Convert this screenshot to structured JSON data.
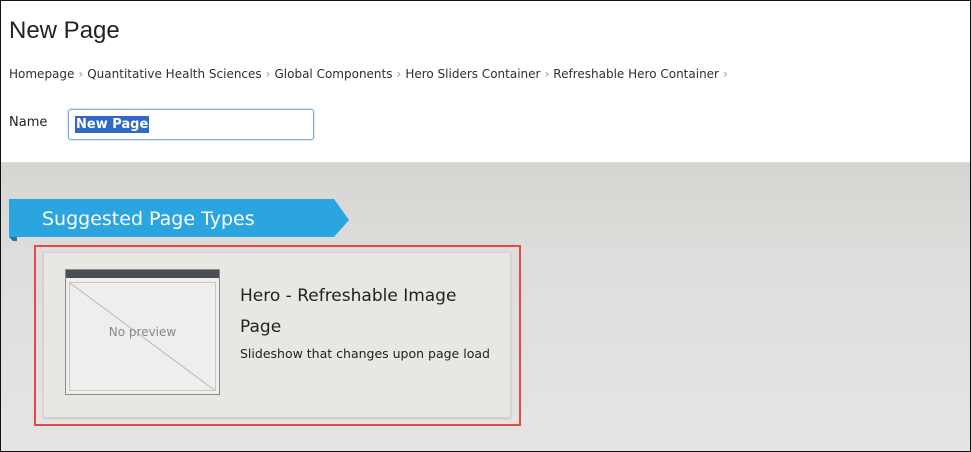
{
  "page": {
    "title": "New Page"
  },
  "breadcrumb": {
    "items": [
      "Homepage",
      "Quantitative Health Sciences",
      "Global Components",
      "Hero Sliders Container",
      "Refreshable Hero Container"
    ],
    "separator": "›"
  },
  "name_field": {
    "label": "Name",
    "value": "New Page"
  },
  "suggested": {
    "heading": "Suggested Page Types",
    "cards": [
      {
        "title": "Hero - Refreshable Image Page",
        "description": "Slideshow that changes upon page load",
        "preview_text": "No preview"
      }
    ]
  },
  "colors": {
    "banner": "#2aa5df",
    "highlight": "#e24a4a",
    "selection": "#3168c6"
  }
}
